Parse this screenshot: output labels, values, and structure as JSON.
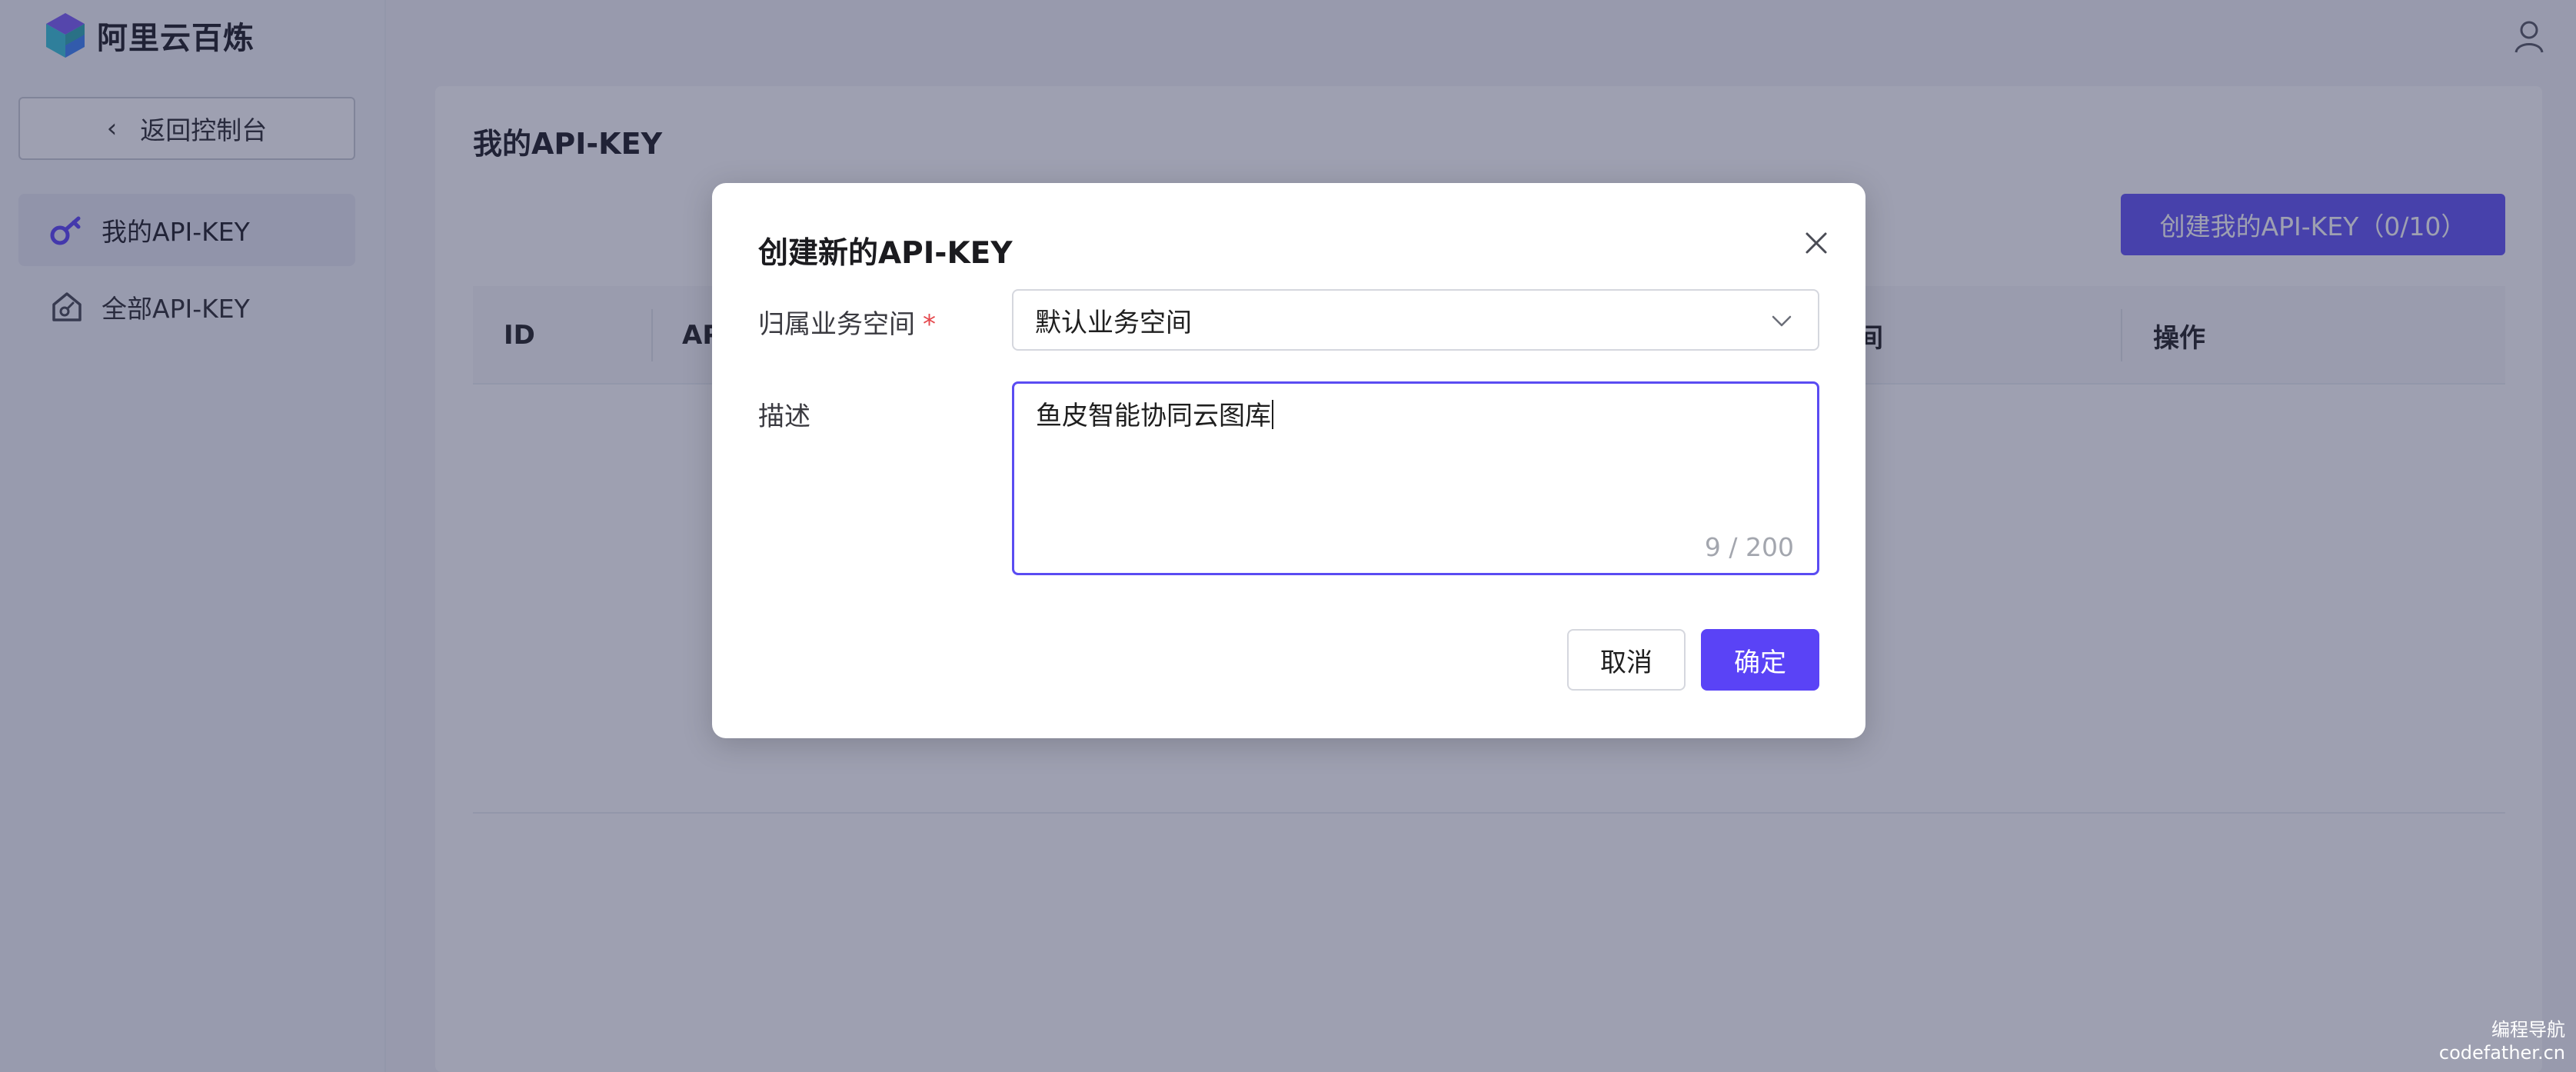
{
  "app": {
    "name": "阿里云百炼"
  },
  "sidebar": {
    "back_label": "返回控制台",
    "items": [
      {
        "label": "我的API-KEY",
        "icon": "key-icon",
        "active": true
      },
      {
        "label": "全部API-KEY",
        "icon": "house-key-icon",
        "active": false
      }
    ]
  },
  "main": {
    "title": "我的API-KEY",
    "create_button": "创建我的API-KEY（0/10）",
    "table": {
      "columns": [
        "ID",
        "AP",
        "间",
        "操作"
      ]
    }
  },
  "modal": {
    "title": "创建新的API-KEY",
    "fields": {
      "workspace": {
        "label": "归属业务空间",
        "required_mark": "*",
        "value": "默认业务空间"
      },
      "description": {
        "label": "描述",
        "value": "鱼皮智能协同云图库",
        "counter": "9 / 200"
      }
    },
    "cancel_label": "取消",
    "confirm_label": "确定"
  },
  "watermark": {
    "line1": "编程导航",
    "line2": "codefather.cn"
  },
  "colors": {
    "accent": "#5a43f6",
    "overlay": "#5c5f7e",
    "required": "#e5484d"
  }
}
